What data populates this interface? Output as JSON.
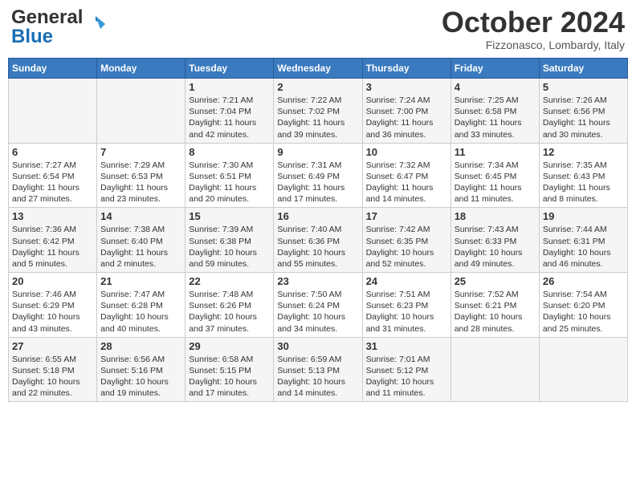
{
  "logo": {
    "text_general": "General",
    "text_blue": "Blue"
  },
  "title": "October 2024",
  "location": "Fizzonasco, Lombardy, Italy",
  "days_of_week": [
    "Sunday",
    "Monday",
    "Tuesday",
    "Wednesday",
    "Thursday",
    "Friday",
    "Saturday"
  ],
  "weeks": [
    [
      {
        "day": "",
        "sunrise": "",
        "sunset": "",
        "daylight": ""
      },
      {
        "day": "",
        "sunrise": "",
        "sunset": "",
        "daylight": ""
      },
      {
        "day": "1",
        "sunrise": "Sunrise: 7:21 AM",
        "sunset": "Sunset: 7:04 PM",
        "daylight": "Daylight: 11 hours and 42 minutes."
      },
      {
        "day": "2",
        "sunrise": "Sunrise: 7:22 AM",
        "sunset": "Sunset: 7:02 PM",
        "daylight": "Daylight: 11 hours and 39 minutes."
      },
      {
        "day": "3",
        "sunrise": "Sunrise: 7:24 AM",
        "sunset": "Sunset: 7:00 PM",
        "daylight": "Daylight: 11 hours and 36 minutes."
      },
      {
        "day": "4",
        "sunrise": "Sunrise: 7:25 AM",
        "sunset": "Sunset: 6:58 PM",
        "daylight": "Daylight: 11 hours and 33 minutes."
      },
      {
        "day": "5",
        "sunrise": "Sunrise: 7:26 AM",
        "sunset": "Sunset: 6:56 PM",
        "daylight": "Daylight: 11 hours and 30 minutes."
      }
    ],
    [
      {
        "day": "6",
        "sunrise": "Sunrise: 7:27 AM",
        "sunset": "Sunset: 6:54 PM",
        "daylight": "Daylight: 11 hours and 27 minutes."
      },
      {
        "day": "7",
        "sunrise": "Sunrise: 7:29 AM",
        "sunset": "Sunset: 6:53 PM",
        "daylight": "Daylight: 11 hours and 23 minutes."
      },
      {
        "day": "8",
        "sunrise": "Sunrise: 7:30 AM",
        "sunset": "Sunset: 6:51 PM",
        "daylight": "Daylight: 11 hours and 20 minutes."
      },
      {
        "day": "9",
        "sunrise": "Sunrise: 7:31 AM",
        "sunset": "Sunset: 6:49 PM",
        "daylight": "Daylight: 11 hours and 17 minutes."
      },
      {
        "day": "10",
        "sunrise": "Sunrise: 7:32 AM",
        "sunset": "Sunset: 6:47 PM",
        "daylight": "Daylight: 11 hours and 14 minutes."
      },
      {
        "day": "11",
        "sunrise": "Sunrise: 7:34 AM",
        "sunset": "Sunset: 6:45 PM",
        "daylight": "Daylight: 11 hours and 11 minutes."
      },
      {
        "day": "12",
        "sunrise": "Sunrise: 7:35 AM",
        "sunset": "Sunset: 6:43 PM",
        "daylight": "Daylight: 11 hours and 8 minutes."
      }
    ],
    [
      {
        "day": "13",
        "sunrise": "Sunrise: 7:36 AM",
        "sunset": "Sunset: 6:42 PM",
        "daylight": "Daylight: 11 hours and 5 minutes."
      },
      {
        "day": "14",
        "sunrise": "Sunrise: 7:38 AM",
        "sunset": "Sunset: 6:40 PM",
        "daylight": "Daylight: 11 hours and 2 minutes."
      },
      {
        "day": "15",
        "sunrise": "Sunrise: 7:39 AM",
        "sunset": "Sunset: 6:38 PM",
        "daylight": "Daylight: 10 hours and 59 minutes."
      },
      {
        "day": "16",
        "sunrise": "Sunrise: 7:40 AM",
        "sunset": "Sunset: 6:36 PM",
        "daylight": "Daylight: 10 hours and 55 minutes."
      },
      {
        "day": "17",
        "sunrise": "Sunrise: 7:42 AM",
        "sunset": "Sunset: 6:35 PM",
        "daylight": "Daylight: 10 hours and 52 minutes."
      },
      {
        "day": "18",
        "sunrise": "Sunrise: 7:43 AM",
        "sunset": "Sunset: 6:33 PM",
        "daylight": "Daylight: 10 hours and 49 minutes."
      },
      {
        "day": "19",
        "sunrise": "Sunrise: 7:44 AM",
        "sunset": "Sunset: 6:31 PM",
        "daylight": "Daylight: 10 hours and 46 minutes."
      }
    ],
    [
      {
        "day": "20",
        "sunrise": "Sunrise: 7:46 AM",
        "sunset": "Sunset: 6:29 PM",
        "daylight": "Daylight: 10 hours and 43 minutes."
      },
      {
        "day": "21",
        "sunrise": "Sunrise: 7:47 AM",
        "sunset": "Sunset: 6:28 PM",
        "daylight": "Daylight: 10 hours and 40 minutes."
      },
      {
        "day": "22",
        "sunrise": "Sunrise: 7:48 AM",
        "sunset": "Sunset: 6:26 PM",
        "daylight": "Daylight: 10 hours and 37 minutes."
      },
      {
        "day": "23",
        "sunrise": "Sunrise: 7:50 AM",
        "sunset": "Sunset: 6:24 PM",
        "daylight": "Daylight: 10 hours and 34 minutes."
      },
      {
        "day": "24",
        "sunrise": "Sunrise: 7:51 AM",
        "sunset": "Sunset: 6:23 PM",
        "daylight": "Daylight: 10 hours and 31 minutes."
      },
      {
        "day": "25",
        "sunrise": "Sunrise: 7:52 AM",
        "sunset": "Sunset: 6:21 PM",
        "daylight": "Daylight: 10 hours and 28 minutes."
      },
      {
        "day": "26",
        "sunrise": "Sunrise: 7:54 AM",
        "sunset": "Sunset: 6:20 PM",
        "daylight": "Daylight: 10 hours and 25 minutes."
      }
    ],
    [
      {
        "day": "27",
        "sunrise": "Sunrise: 6:55 AM",
        "sunset": "Sunset: 5:18 PM",
        "daylight": "Daylight: 10 hours and 22 minutes."
      },
      {
        "day": "28",
        "sunrise": "Sunrise: 6:56 AM",
        "sunset": "Sunset: 5:16 PM",
        "daylight": "Daylight: 10 hours and 19 minutes."
      },
      {
        "day": "29",
        "sunrise": "Sunrise: 6:58 AM",
        "sunset": "Sunset: 5:15 PM",
        "daylight": "Daylight: 10 hours and 17 minutes."
      },
      {
        "day": "30",
        "sunrise": "Sunrise: 6:59 AM",
        "sunset": "Sunset: 5:13 PM",
        "daylight": "Daylight: 10 hours and 14 minutes."
      },
      {
        "day": "31",
        "sunrise": "Sunrise: 7:01 AM",
        "sunset": "Sunset: 5:12 PM",
        "daylight": "Daylight: 10 hours and 11 minutes."
      },
      {
        "day": "",
        "sunrise": "",
        "sunset": "",
        "daylight": ""
      },
      {
        "day": "",
        "sunrise": "",
        "sunset": "",
        "daylight": ""
      }
    ]
  ]
}
